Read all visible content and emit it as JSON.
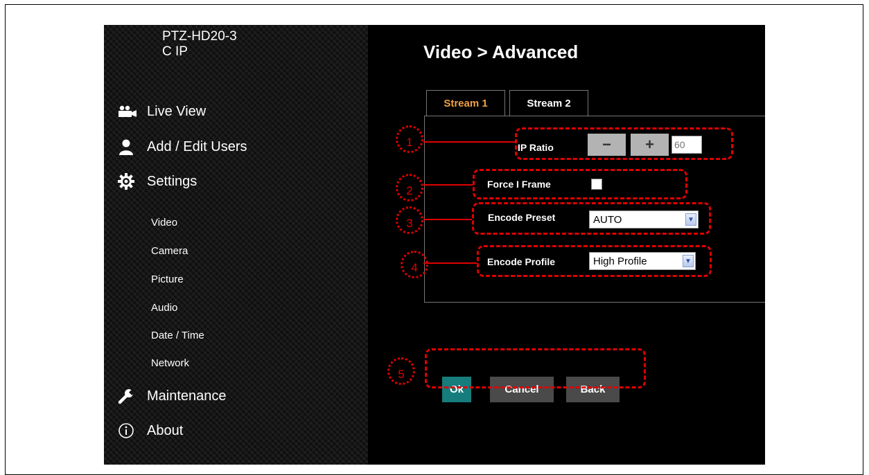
{
  "device": {
    "name": "PTZ-HD20-3\nC IP"
  },
  "sidebar": {
    "menu": [
      {
        "label": "Live View",
        "icon": "video-camera-icon"
      },
      {
        "label": "Add / Edit Users",
        "icon": "user-icon"
      },
      {
        "label": "Settings",
        "icon": "gear-icon"
      }
    ],
    "settings_subitems": [
      "Video",
      "Camera",
      "Picture",
      "Audio",
      "Date / Time",
      "Network"
    ],
    "bottom_menu": [
      {
        "label": "Maintenance",
        "icon": "wrench-icon"
      },
      {
        "label": "About",
        "icon": "info-icon"
      }
    ]
  },
  "page": {
    "title": "Video > Advanced"
  },
  "tabs": [
    {
      "label": "Stream 1",
      "active": true
    },
    {
      "label": "Stream 2",
      "active": false
    }
  ],
  "form": {
    "ip_ratio": {
      "label": "IP Ratio",
      "minus": "−",
      "plus": "+",
      "value": "60"
    },
    "force_i_frame": {
      "label": "Force I Frame",
      "checked": false
    },
    "encode_preset": {
      "label": "Encode Preset",
      "value": "AUTO"
    },
    "encode_profile": {
      "label": "Encode Profile",
      "value": "High Profile"
    }
  },
  "buttons": {
    "ok": "Ok",
    "cancel": "Cancel",
    "back": "Back"
  },
  "callouts": [
    "1",
    "2",
    "3",
    "4",
    "5"
  ],
  "colors": {
    "active_tab": "#f0a040",
    "ok_button": "#177c7c",
    "secondary_button": "#4a4a4a",
    "callout_red": "#e00000"
  }
}
